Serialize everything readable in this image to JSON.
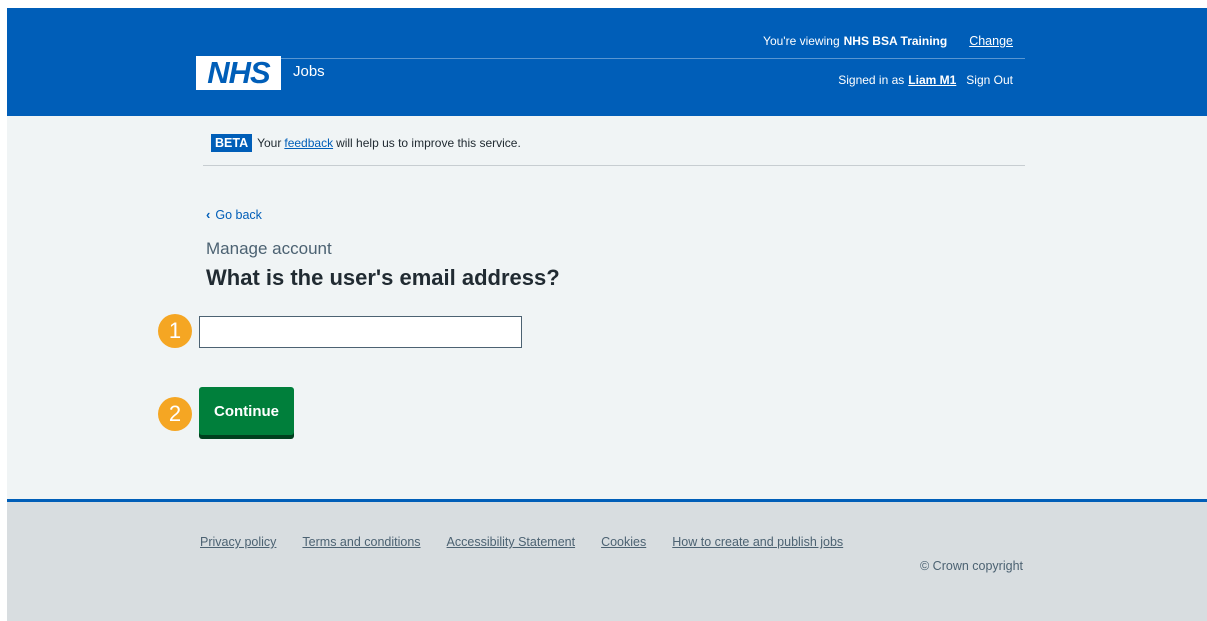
{
  "header": {
    "logo": "NHS",
    "service_name": "Jobs",
    "viewing_prefix": "You're viewing",
    "viewing_org": "NHS BSA Training",
    "change_label": "Change",
    "signed_in_prefix": "Signed in as",
    "user_name": "Liam M1",
    "sign_out_label": "Sign Out"
  },
  "beta_banner": {
    "tag": "BETA",
    "text_before": "Your",
    "feedback_link": "feedback",
    "text_after": "will help us to improve this service."
  },
  "main": {
    "back_label": "Go back",
    "caption": "Manage account",
    "heading": "What is the user's email address?",
    "email_value": "",
    "continue_label": "Continue"
  },
  "markers": [
    "1",
    "2"
  ],
  "footer": {
    "links": [
      "Privacy policy",
      "Terms and conditions",
      "Accessibility Statement",
      "Cookies",
      "How to create and publish jobs"
    ],
    "copyright": "© Crown copyright"
  },
  "colors": {
    "nhs_blue": "#005eb8",
    "button_green": "#007f3b",
    "marker_orange": "#f5a623",
    "page_bg": "#f0f4f5",
    "footer_bg": "#d8dde0"
  }
}
